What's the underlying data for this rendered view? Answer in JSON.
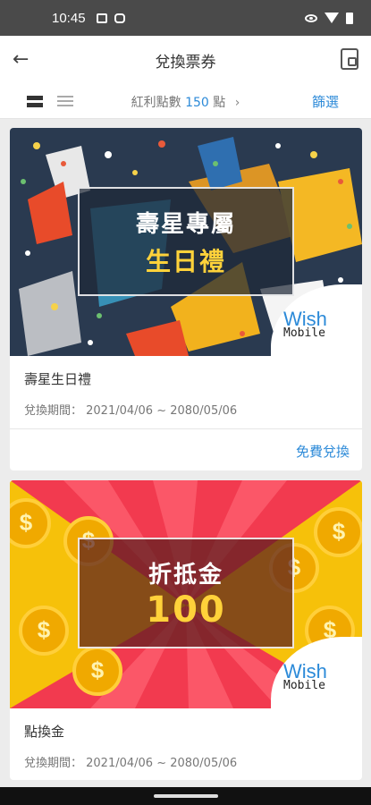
{
  "status": {
    "time": "10:45"
  },
  "header": {
    "title": "兌換票券",
    "back_icon": "arrow-left-icon",
    "wallet_icon": "wallet-icon"
  },
  "subbar": {
    "points_label": "紅利點數",
    "points_value": "150",
    "points_unit": "點",
    "chevron": "›",
    "filter_label": "篩選"
  },
  "cards": [
    {
      "banner_line1": "壽星專屬",
      "banner_line2": "生日禮",
      "brand_wish": "Wish",
      "brand_mobile": "Mobile",
      "title": "壽星生日禮",
      "period": "兌換期間： 2021/04/06 ~ 2080/05/06",
      "action": "免費兌換"
    },
    {
      "banner_line1": "折抵金",
      "banner_line2": "100",
      "brand_wish": "Wish",
      "brand_mobile": "Mobile",
      "title": "點換金",
      "period": "兌換期間： 2021/04/06 ~ 2080/05/06"
    }
  ],
  "colors": {
    "accent": "#2c8ad8",
    "status_bar": "#4a4a4a",
    "gold": "#ffd23a"
  }
}
